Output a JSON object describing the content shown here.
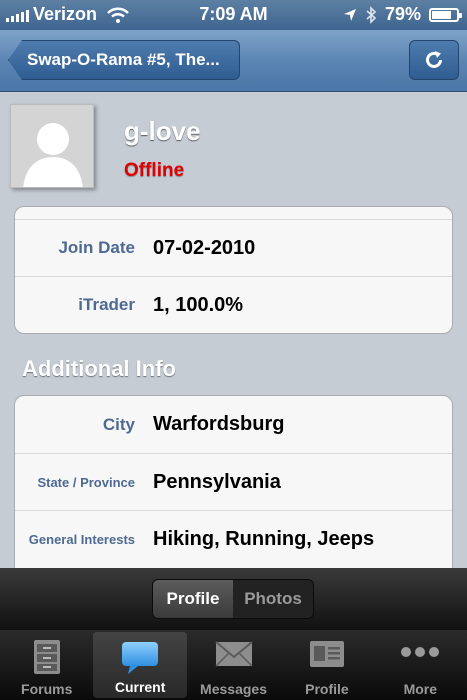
{
  "status_bar": {
    "carrier": "Verizon",
    "time": "7:09 AM",
    "battery": "79%"
  },
  "nav": {
    "back_label": "Swap-O-Rama #5, The..."
  },
  "profile": {
    "username": "g-love",
    "status": "Offline"
  },
  "info": [
    {
      "label": "Join Date",
      "value": "07-02-2010"
    },
    {
      "label": "iTrader",
      "value": "1, 100.0%"
    }
  ],
  "additional": {
    "title": "Additional Info",
    "rows": [
      {
        "label": "City",
        "value": "Warfordsburg"
      },
      {
        "label": "State / Province",
        "value": "Pennsylvania"
      },
      {
        "label": "General Interests",
        "value": "Hiking, Running, Jeeps"
      }
    ]
  },
  "segment": {
    "profile": "Profile",
    "photos": "Photos"
  },
  "tabs": {
    "forums": "Forums",
    "current": "Current",
    "messages": "Messages",
    "profile": "Profile",
    "more": "More"
  },
  "colors": {
    "nav": "#5b85b3",
    "offline": "#e00000",
    "label": "#4e6a92"
  }
}
